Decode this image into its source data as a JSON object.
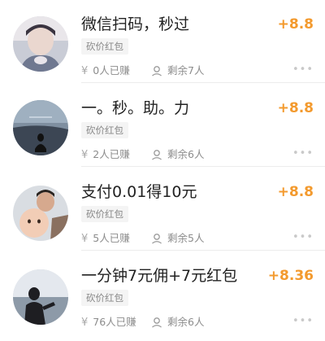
{
  "tasks": [
    {
      "title": "微信扫码，秒过",
      "amount": "+8.8",
      "tag": "砍价红包",
      "earned": "0人已赚",
      "remaining": "剩余7人"
    },
    {
      "title": "一。秒。助。力",
      "amount": "+8.8",
      "tag": "砍价红包",
      "earned": "2人已赚",
      "remaining": "剩余6人"
    },
    {
      "title": "支付0.01得10元",
      "amount": "+8.8",
      "tag": "砍价红包",
      "earned": "5人已赚",
      "remaining": "剩余5人"
    },
    {
      "title": "一分钟7元佣+7元红包",
      "amount": "+8.36",
      "tag": "砍价红包",
      "earned": "76人已赚",
      "remaining": "剩余6人"
    }
  ],
  "icons": {
    "currency": "yuan-icon",
    "person": "person-icon",
    "more": "more-icon"
  },
  "colors": {
    "amount": "#f39a2e",
    "text": "#222222",
    "muted": "#8c8c8c"
  }
}
